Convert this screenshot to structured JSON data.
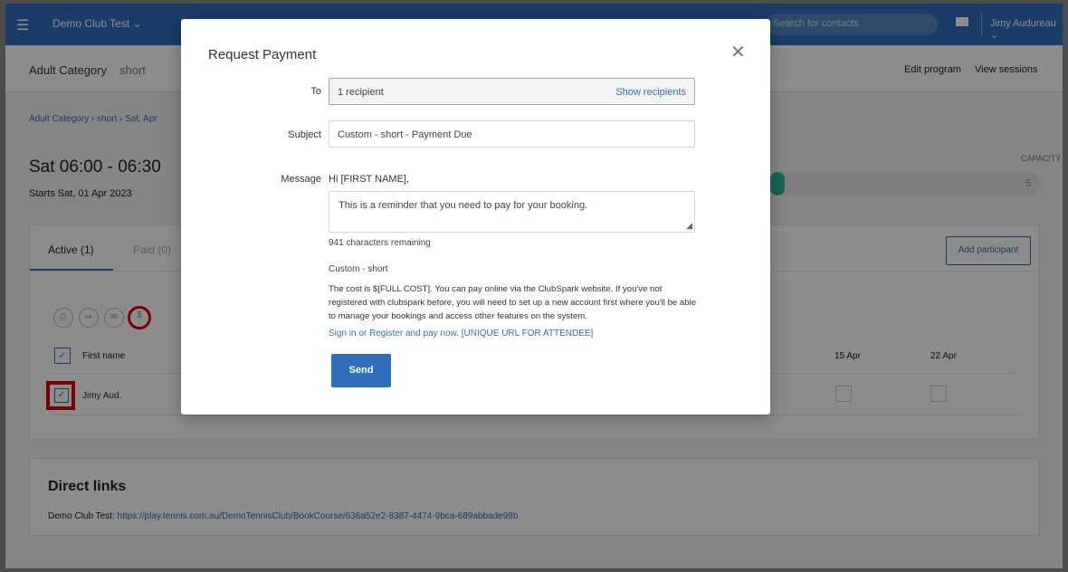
{
  "topbar": {
    "club_name": "Demo Club Test",
    "search_placeholder": "Search for contacts",
    "user_name": "Jimy Audureau"
  },
  "subbar": {
    "category": "Adult Category",
    "program": "short",
    "edit_program": "Edit program",
    "view_sessions": "View sessions"
  },
  "breadcrumb": "Adult Category  ›  short  ›  Sat, Apr",
  "session": {
    "time": "Sat 06:00 - 06:30",
    "starts": "Starts Sat, 01 Apr 2023",
    "capacity_label": "CAPACITY",
    "capacity_value": "5"
  },
  "participants": {
    "tab_active": "Active (1)",
    "tab_paid": "Paid (0)",
    "add_button": "Add participant",
    "col_first_name": "First name",
    "col_date1": "15 Apr",
    "col_date2": "22 Apr",
    "rows": [
      {
        "name": "Jimy Aud."
      }
    ]
  },
  "direct_links": {
    "heading": "Direct links",
    "label": "Demo Club Test: ",
    "url": "https://play.tennis.com.au/DemoTennisClub/BookCourse/636a52e2-8387-4474-9bca-689abbade98b"
  },
  "modal": {
    "title": "Request Payment",
    "close_glyph": "✕",
    "to_label": "To",
    "to_value": "1 recipient",
    "show_recipients": "Show recipients",
    "subject_label": "Subject",
    "subject_value": "Custom - short - Payment Due",
    "message_label": "Message",
    "greeting": "Hi [FIRST NAME],",
    "message_value": "This is a reminder that you need to pay for your booking.",
    "remaining": "941 characters remaining",
    "cost_title": "Custom - short",
    "cost_body": "The cost is $[FULL COST]. You can pay online via the ClubSpark website. If you've not registered with clubspark before, you will need to set up a new account first where you'll be able to manage your bookings and access other features on the system.",
    "cost_link": "Sign in or Register and pay now. [UNIQUE URL FOR ATTENDEE]",
    "send": "Send"
  }
}
